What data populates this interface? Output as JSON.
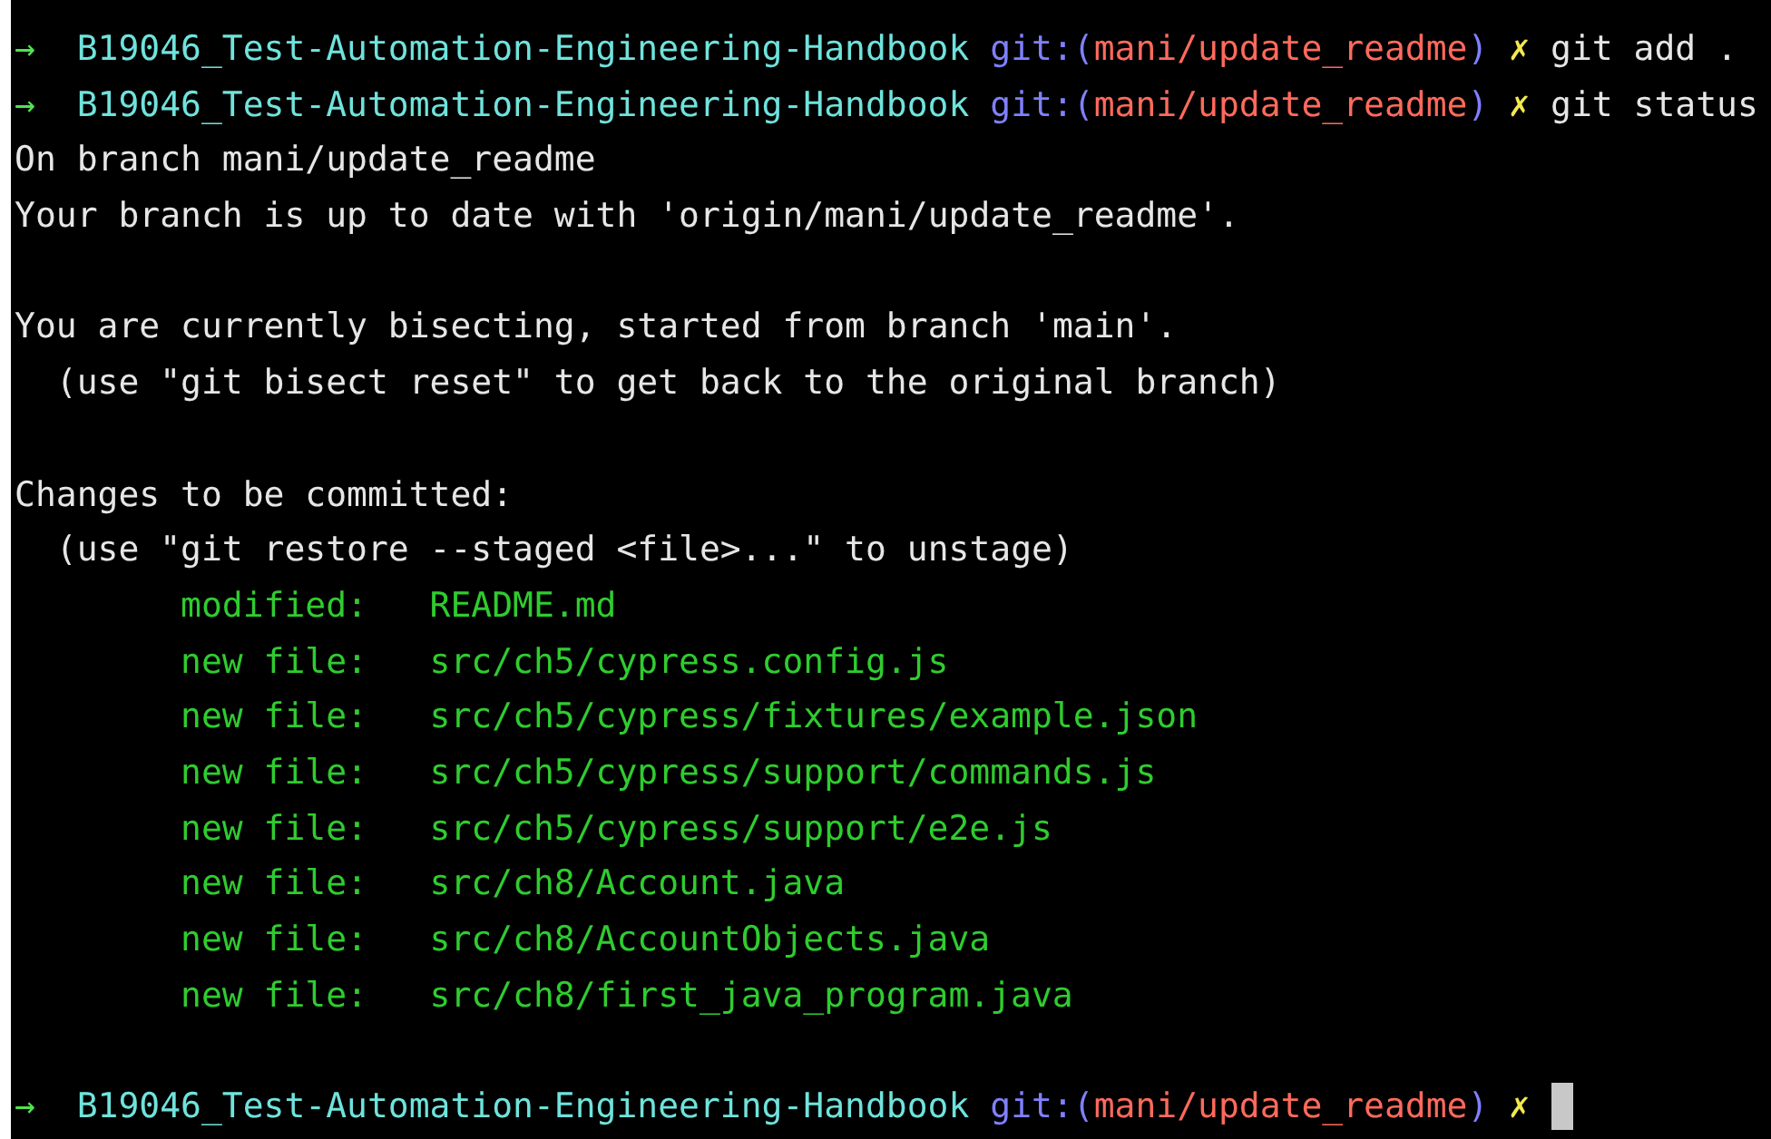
{
  "terminal": {
    "lines": [
      {
        "kind": "prompt",
        "arrow": "→",
        "directory": "B19046_Test-Automation-Engineering-Handbook",
        "vcs_open": "git:(",
        "branch": "mani/update_readme",
        "vcs_close": ")",
        "dirty_mark": "✗",
        "command": "git add .",
        "cursor": false
      },
      {
        "kind": "prompt",
        "arrow": "→",
        "directory": "B19046_Test-Automation-Engineering-Handbook",
        "vcs_open": "git:(",
        "branch": "mani/update_readme",
        "vcs_close": ")",
        "dirty_mark": "✗",
        "command": "git status",
        "cursor": false
      },
      {
        "kind": "text",
        "text": "On branch mani/update_readme"
      },
      {
        "kind": "text",
        "text": "Your branch is up to date with 'origin/mani/update_readme'."
      },
      {
        "kind": "blank"
      },
      {
        "kind": "text",
        "text": "You are currently bisecting, started from branch 'main'."
      },
      {
        "kind": "text",
        "text": "  (use \"git bisect reset\" to get back to the original branch)"
      },
      {
        "kind": "blank"
      },
      {
        "kind": "text",
        "text": "Changes to be committed:"
      },
      {
        "kind": "text",
        "text": "  (use \"git restore --staged <file>...\" to unstage)"
      },
      {
        "kind": "staged",
        "status": "modified:",
        "path": "README.md"
      },
      {
        "kind": "staged",
        "status": "new file:",
        "path": "src/ch5/cypress.config.js"
      },
      {
        "kind": "staged",
        "status": "new file:",
        "path": "src/ch5/cypress/fixtures/example.json"
      },
      {
        "kind": "staged",
        "status": "new file:",
        "path": "src/ch5/cypress/support/commands.js"
      },
      {
        "kind": "staged",
        "status": "new file:",
        "path": "src/ch5/cypress/support/e2e.js"
      },
      {
        "kind": "staged",
        "status": "new file:",
        "path": "src/ch8/Account.java"
      },
      {
        "kind": "staged",
        "status": "new file:",
        "path": "src/ch8/AccountObjects.java"
      },
      {
        "kind": "staged",
        "status": "new file:",
        "path": "src/ch8/first_java_program.java"
      },
      {
        "kind": "blank"
      },
      {
        "kind": "prompt",
        "arrow": "→",
        "directory": "B19046_Test-Automation-Engineering-Handbook",
        "vcs_open": "git:(",
        "branch": "mani/update_readme",
        "vcs_close": ")",
        "dirty_mark": "✗",
        "cursor": true
      }
    ]
  }
}
